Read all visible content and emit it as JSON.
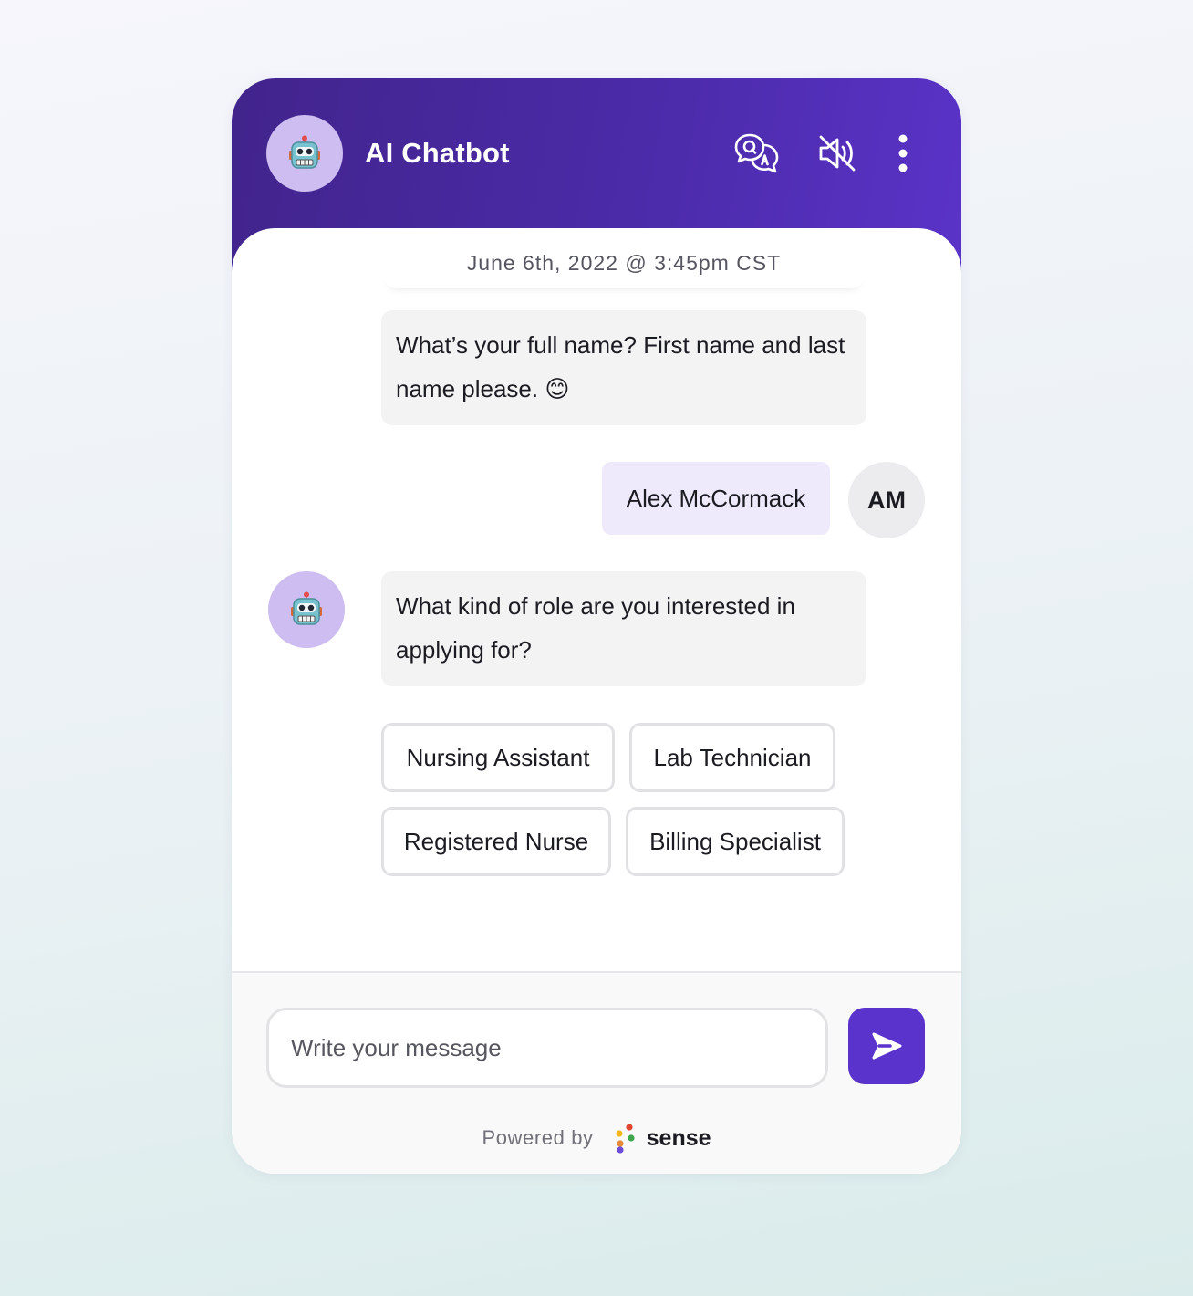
{
  "header": {
    "title": "AI Chatbot",
    "bot_avatar_icon": "robot-icon",
    "actions": [
      {
        "name": "qa-icon",
        "label": "Q&A"
      },
      {
        "name": "sound-off-icon",
        "label": "Mute"
      },
      {
        "name": "more-vertical-icon",
        "label": "More"
      }
    ]
  },
  "conversation": {
    "timestamp": "June 6th, 2022 @ 3:45pm CST",
    "messages": [
      {
        "from": "bot",
        "text": "What’s your full name? First name and last name please. 😊"
      },
      {
        "from": "user",
        "text": "Alex McCormack",
        "avatar_initials": "AM"
      },
      {
        "from": "bot",
        "text": "What kind of role are you interested in applying for?"
      }
    ],
    "quick_replies": [
      "Nursing Assistant",
      "Lab Technician",
      "Registered Nurse",
      "Billing Specialist"
    ]
  },
  "composer": {
    "placeholder": "Write your message",
    "send_icon": "send-icon"
  },
  "footer": {
    "powered_by": "Powered by",
    "brand": "sense"
  },
  "colors": {
    "header_start": "#42248c",
    "header_end": "#5a33c8",
    "accent": "#5a32cc",
    "bot_avatar_bg": "#cdbdf0",
    "user_bubble": "#efeafb",
    "bot_bubble": "#f3f3f4"
  }
}
